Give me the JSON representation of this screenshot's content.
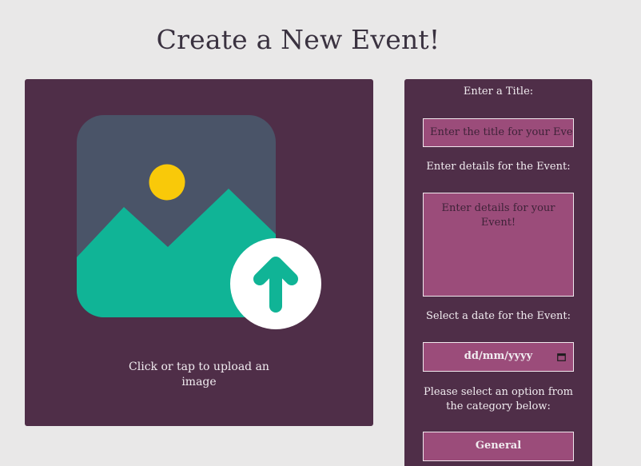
{
  "page": {
    "title": "Create a New Event!"
  },
  "upload": {
    "caption": "Click or tap to upload an image",
    "icon": "image-upload-icon"
  },
  "form": {
    "title_label": "Enter a Title:",
    "title_placeholder": "Enter the title for your Event",
    "details_label": "Enter details for the Event:",
    "details_placeholder": "Enter details for your Event!",
    "date_label": "Select a date for the Event:",
    "date_placeholder": "dd/mm/yyyy",
    "date_icon": "calendar-icon",
    "category_label": "Please select an option from the category below:",
    "category_selected": "General"
  },
  "colors": {
    "background": "#e9e8e8",
    "panel": "#4f2e48",
    "field": "#9b4c7a",
    "field_border": "#f1e8ee",
    "image_frame": "#4a5468",
    "sun": "#f9c909",
    "mountains": "#10b496",
    "upload_arrow": "#10b496"
  }
}
